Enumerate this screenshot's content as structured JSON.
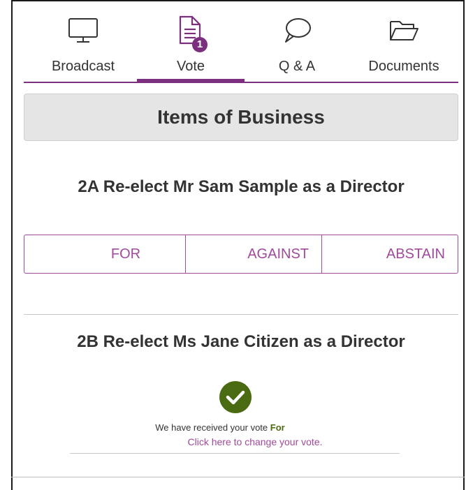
{
  "tabs": [
    {
      "label": "Broadcast",
      "icon": "monitor-icon"
    },
    {
      "label": "Vote",
      "icon": "document-icon",
      "badge": "1"
    },
    {
      "label": "Q & A",
      "icon": "speech-bubble-icon"
    },
    {
      "label": "Documents",
      "icon": "folder-icon"
    }
  ],
  "active_tab": "Vote",
  "section": {
    "title": "Items of Business"
  },
  "items": [
    {
      "title": "2A Re-elect Mr Sam Sample as a Director",
      "options": [
        "FOR",
        "AGAINST",
        "ABSTAIN"
      ]
    },
    {
      "title": "2B Re-elect Ms Jane Citizen as a Director",
      "received_text": "We have received your vote",
      "vote_value": "For",
      "change_link": "Click here to change your vote."
    }
  ],
  "colors": {
    "accent": "#7b2f7e",
    "option": "#a04a9c",
    "success": "#4a6b12",
    "header_bg": "#e5e5e5"
  }
}
